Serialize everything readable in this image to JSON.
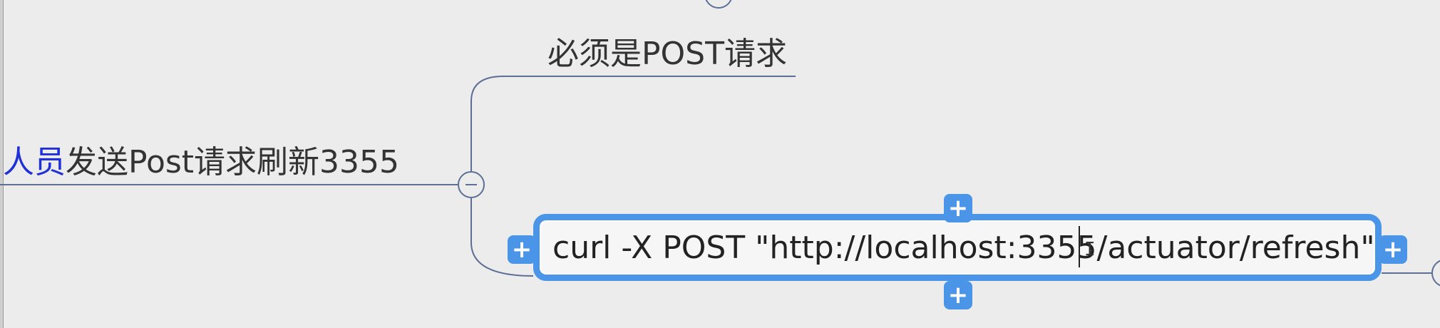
{
  "mindmap": {
    "parent_topic": {
      "link_text": "人员",
      "text": "发送Post请求刷新3355"
    },
    "child_topics": [
      {
        "text": "必须是POST请求"
      },
      {
        "text": "curl -X POST \"http://localhost:3355/actuator/refresh\""
      }
    ],
    "controls": {
      "add_symbol": "+"
    }
  },
  "colors": {
    "background": "#ececec",
    "connector": "#5d6f95",
    "selection": "#4a95e8",
    "link_text": "#2030d8"
  }
}
